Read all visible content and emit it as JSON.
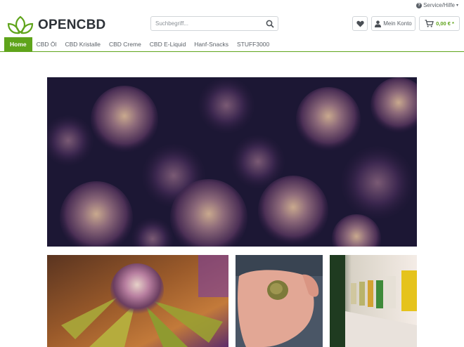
{
  "topbar": {
    "service_label": "Service/Hilfe"
  },
  "header": {
    "logo_text": "OPENCBD",
    "search_placeholder": "Suchbegriff...",
    "account_label": "Mein Konto",
    "cart_total": "0,00 € *"
  },
  "nav": {
    "items": [
      {
        "label": "Home",
        "active": true
      },
      {
        "label": "CBD Öl"
      },
      {
        "label": "CBD Kristalle"
      },
      {
        "label": "CBD Creme"
      },
      {
        "label": "CBD E-Liquid"
      },
      {
        "label": "Hanf-Snacks"
      },
      {
        "label": "STUFF3000"
      }
    ]
  },
  "colors": {
    "brand_green": "#5fa41b",
    "text": "#5a6067",
    "border": "#d1d5d9"
  },
  "icons": [
    "question-icon",
    "chevron-down-icon",
    "leaf-logo-icon",
    "search-icon",
    "heart-icon",
    "user-icon",
    "cart-icon"
  ]
}
